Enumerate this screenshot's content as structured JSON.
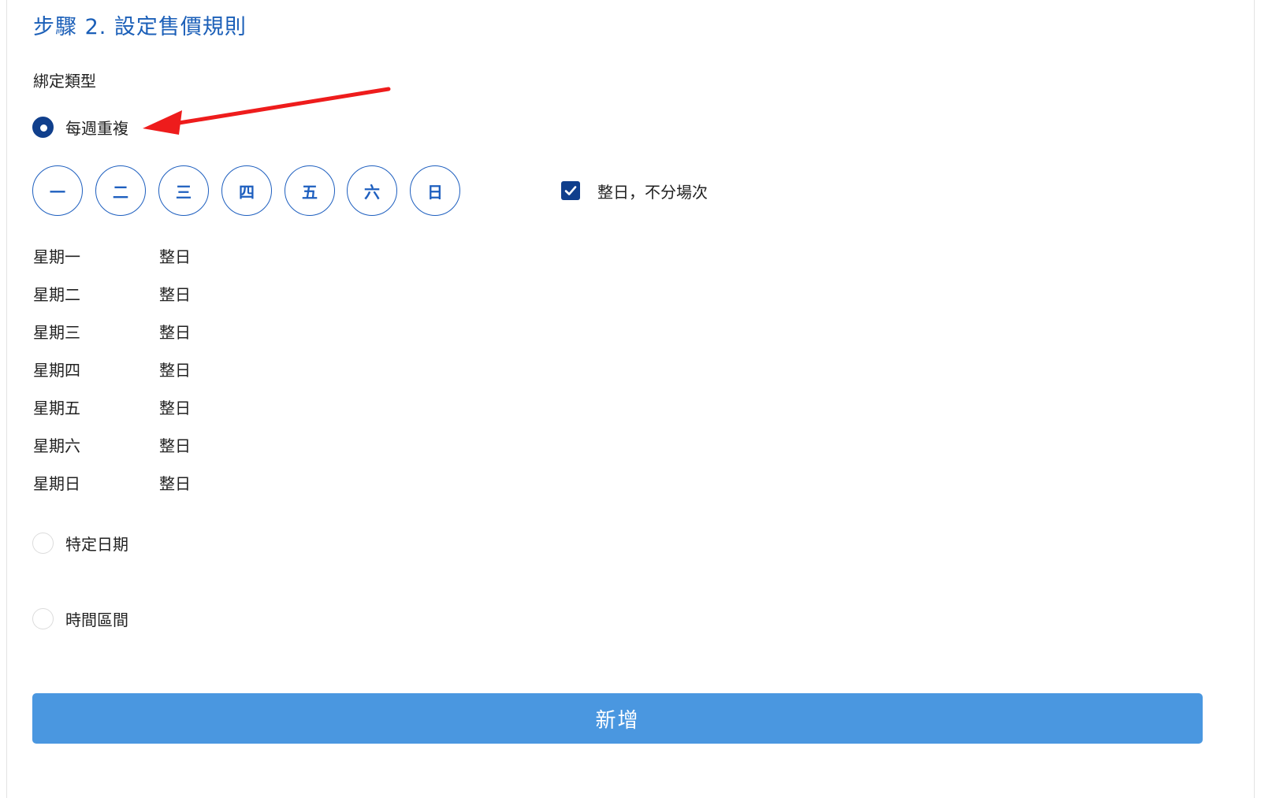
{
  "page": {
    "heading": "步驟 2. 設定售價規則",
    "section_label": "綁定類型"
  },
  "binding_types": [
    {
      "label": "每週重複",
      "checked": true
    },
    {
      "label": "特定日期",
      "checked": false
    },
    {
      "label": "時間區間",
      "checked": false
    }
  ],
  "weekday_buttons": [
    "一",
    "二",
    "三",
    "四",
    "五",
    "六",
    "日"
  ],
  "all_day_option": {
    "label": "整日，不分場次",
    "checked": true
  },
  "schedule": [
    {
      "day": "星期一",
      "value": "整日"
    },
    {
      "day": "星期二",
      "value": "整日"
    },
    {
      "day": "星期三",
      "value": "整日"
    },
    {
      "day": "星期四",
      "value": "整日"
    },
    {
      "day": "星期五",
      "value": "整日"
    },
    {
      "day": "星期六",
      "value": "整日"
    },
    {
      "day": "星期日",
      "value": "整日"
    }
  ],
  "submit": {
    "label": "新增"
  },
  "colors": {
    "heading": "#1b5fb8",
    "accent_dark": "#103f8c",
    "button": "#4a97e0",
    "annotation_arrow": "#ee1c1c"
  },
  "icons": {
    "checkbox": "check-icon",
    "annotation": "annotation-arrow-icon"
  }
}
